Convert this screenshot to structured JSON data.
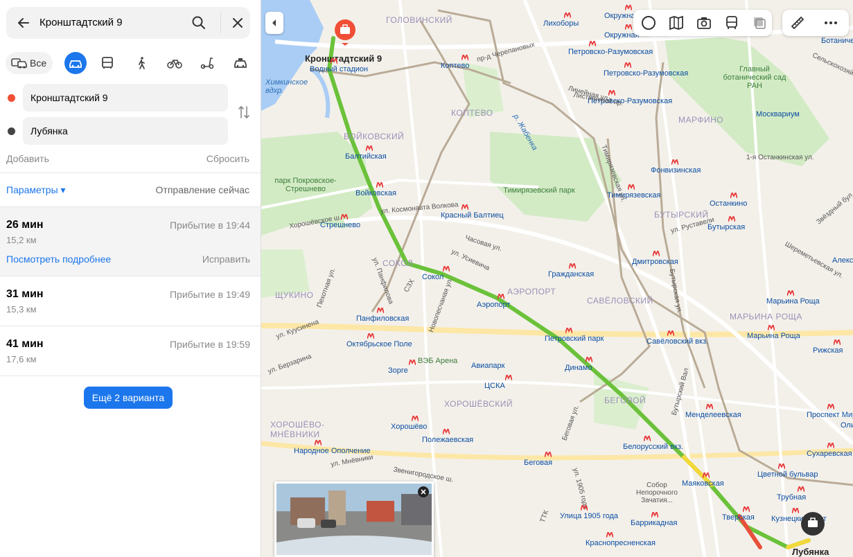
{
  "search": {
    "query": "Кронштадтский 9"
  },
  "modes": {
    "all_label": "Все"
  },
  "points": {
    "from": "Кронштадтский 9",
    "to": "Лубянка"
  },
  "actions": {
    "add": "Добавить",
    "reset": "Сбросить"
  },
  "params": {
    "label": "Параметры ▾",
    "departure": "Отправление сейчас"
  },
  "routes": [
    {
      "duration": "26 мин",
      "distance": "15,2 км",
      "arrival": "Прибытие в 19:44",
      "details": "Посмотреть подробнее",
      "fix": "Исправить"
    },
    {
      "duration": "31 мин",
      "distance": "15,3 км",
      "arrival": "Прибытие в 19:49"
    },
    {
      "duration": "41 мин",
      "distance": "17,6 км",
      "arrival": "Прибытие в 19:59"
    }
  ],
  "more_routes": "Ещё 2 варианта",
  "colors": {
    "accent": "#1c76ec",
    "route_green": "#6bc23a",
    "start_red": "#f04f36"
  },
  "map": {
    "start_label": "Кронштадтский 9",
    "end_label": "Лубянка",
    "districts": [
      "ГОЛОВИНСКИЙ",
      "КОПТЕВО",
      "ВОЙКОВСКИЙ",
      "МАРФИНО",
      "БУТЫРСКИЙ",
      "СОКОЛ",
      "АЭРОПОРТ",
      "САВЁЛОВСКИЙ",
      "ЩУКИНО",
      "МАРЬИНА РОЩА",
      "ХОРОШЁВСКИЙ",
      "БЕГОВОЙ",
      "ХОРОШЁВО-МНЁВНИКИ"
    ],
    "stations": [
      "Водный стадион",
      "Коптево",
      "Лихоборы",
      "Окружная",
      "Петровско-Разумовская",
      "Петровско-Разумовская",
      "Петровско-Разумовская",
      "Балтийская",
      "Войковская",
      "Фонвизинская",
      "Тимирязевская",
      "Останкино",
      "Стрешнево",
      "Красный Балтиец",
      "Бутырская",
      "Дмитровская",
      "Гражданская",
      "Сокол",
      "Аэропорт",
      "Марьина Роща",
      "Марьина Роща",
      "Панфиловская",
      "Петровский парк",
      "Савёловский вкз.",
      "Октябрьское Поле",
      "Динамо",
      "Рижская",
      "Зорге",
      "ЦСКА",
      "Менделеевская",
      "Проспект Мира",
      "Хорошёво",
      "Полежаевская",
      "Белорусский вкз.",
      "Сухаревская",
      "Народное Ополчение",
      "Беговая",
      "Маяковская",
      "Цветной бульвар",
      "Трубная",
      "Улица 1905 года",
      "Тверская",
      "Баррикадная",
      "Кузнецкий мост",
      "Краснопресненская",
      "Окружная"
    ],
    "parks": [
      "парк Покровское-Стрешнево",
      "Тимирязевский парк",
      "Главный ботанический сад РАН",
      "Москвариум",
      "ВЭБ Арена",
      "Авиапарк",
      "Собор Непорочного Зачатия..."
    ],
    "water": [
      "Химкинское вдхр.",
      "р. Жабенка"
    ],
    "streets": [
      "ул. Космонавта Волкова",
      "Часовая ул.",
      "ул. Усиевича",
      "Новопесчаная ул.",
      "ул. Панфилова",
      "ул. Берзарина",
      "Пехотная ул.",
      "Беговая ул.",
      "ул. 1905 года",
      "Бутырский Вал",
      "ул. Руставели",
      "Бутырская ул.",
      "Тимирязевская ул.",
      "Линейная ул.",
      "СЗХ",
      "ТТК",
      "пр-д Черепановых",
      "Листвянный пр.",
      "1-я Останкинская ул.",
      "Сельскохозяйственная ул.",
      "Звёздный бул.",
      "Шереметьевская ул.",
      "ул. Куусинена",
      "Хорошёвское ш.",
      "Звенигородское ш.",
      "ул. Мнёвники"
    ],
    "edge_labels": [
      "Ботанический",
      "Алекс",
      "Олимпи"
    ]
  }
}
